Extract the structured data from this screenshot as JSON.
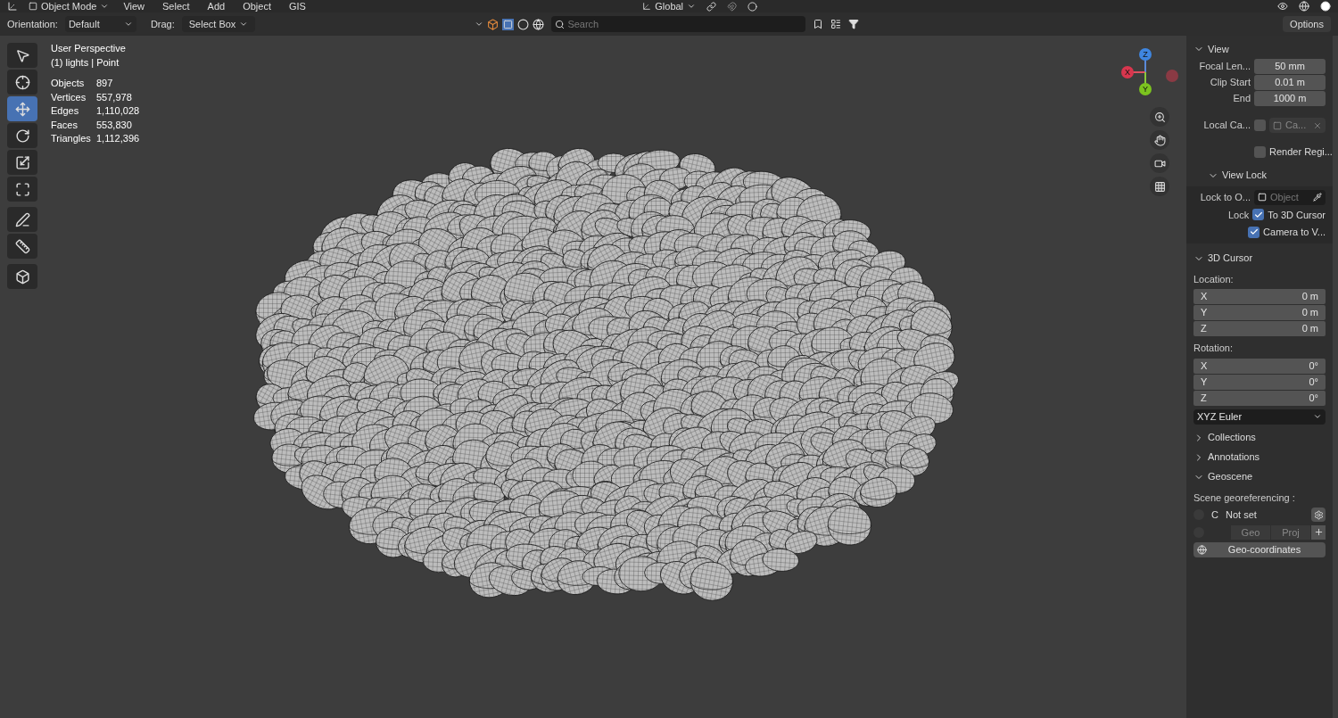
{
  "header": {
    "mode": "Object Mode",
    "menus": [
      "View",
      "Select",
      "Add",
      "Object",
      "GIS"
    ],
    "transform": "Global"
  },
  "tool_settings": {
    "orientation_label": "Orientation:",
    "orientation": "Default",
    "drag_label": "Drag:",
    "drag": "Select Box",
    "search_placeholder": "Search",
    "options": "Options"
  },
  "toolbar": [
    {
      "kind": "select",
      "selected": false
    },
    {
      "kind": "cursor",
      "selected": false
    },
    {
      "kind": "move",
      "selected": true
    },
    {
      "kind": "rotate",
      "selected": false
    },
    {
      "kind": "scale",
      "selected": false
    },
    {
      "kind": "transform",
      "selected": false
    },
    {
      "kind": "annotate",
      "selected": false
    },
    {
      "kind": "measure",
      "selected": false
    },
    {
      "kind": "add",
      "selected": false
    }
  ],
  "overlay": {
    "title": "User Perspective",
    "subtitle": "(1) lights | Point",
    "stats": [
      {
        "label": "Objects",
        "value": "897"
      },
      {
        "label": "Vertices",
        "value": "557,978"
      },
      {
        "label": "Edges",
        "value": "1,110,028"
      },
      {
        "label": "Faces",
        "value": "553,830"
      },
      {
        "label": "Triangles",
        "value": "1,112,396"
      }
    ]
  },
  "gizmo": {
    "z": "Z",
    "x": "X",
    "y": "Y"
  },
  "sidebar": {
    "view": {
      "title": "View",
      "expanded": true,
      "fields": [
        {
          "label": "Focal Len...",
          "value": "50 mm"
        },
        {
          "label": "Clip Start",
          "value": "0.01 m"
        },
        {
          "label": "End",
          "value": "1000 m"
        }
      ],
      "local_camera": {
        "label": "Local Ca...",
        "checked": false,
        "placeholder": "Ca..."
      },
      "render_region": {
        "label": "Render Regi...",
        "checked": false
      },
      "view_lock": {
        "title": "View Lock",
        "expanded": true,
        "lock_to_label": "Lock to O...",
        "lock_to_placeholder": "Object",
        "lock_label": "Lock",
        "checks": [
          {
            "label": "To 3D Cursor",
            "checked": true
          },
          {
            "label": "Camera to V...",
            "checked": true
          }
        ]
      }
    },
    "cursor": {
      "title": "3D Cursor",
      "expanded": true,
      "location_label": "Location:",
      "location": [
        {
          "axis": "X",
          "value": "0 m"
        },
        {
          "axis": "Y",
          "value": "0 m"
        },
        {
          "axis": "Z",
          "value": "0 m"
        }
      ],
      "rotation_label": "Rotation:",
      "rotation": [
        {
          "axis": "X",
          "value": "0°"
        },
        {
          "axis": "Y",
          "value": "0°"
        },
        {
          "axis": "Z",
          "value": "0°"
        }
      ],
      "rotation_mode": "XYZ Euler"
    },
    "collapsed": [
      {
        "title": "Collections",
        "expanded": false
      },
      {
        "title": "Annotations",
        "expanded": false
      }
    ],
    "geoscene": {
      "title": "Geoscene",
      "expanded": true,
      "label": "Scene georeferencing :",
      "radios": [
        {
          "selected": false
        },
        {
          "selected": false
        }
      ],
      "crs_letter": "C",
      "crs": "Not set",
      "geo": "Geo",
      "proj": "Proj",
      "button": "Geo-coordinates"
    }
  }
}
